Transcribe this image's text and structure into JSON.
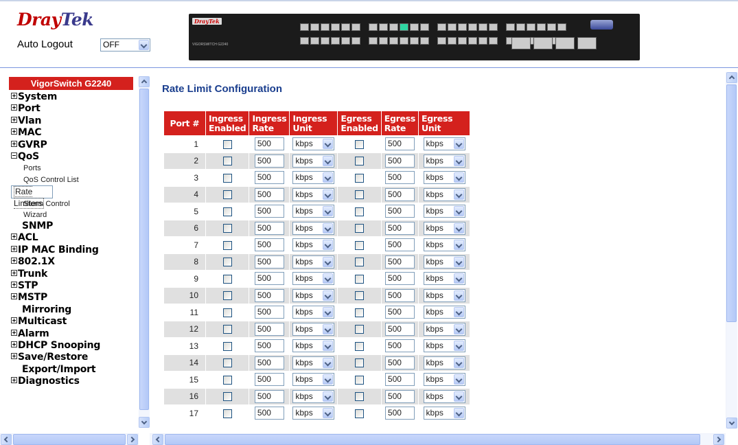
{
  "header": {
    "logo_primary": "Dray",
    "logo_secondary": "Tek",
    "auto_logout_label": "Auto Logout",
    "auto_logout_value": "OFF",
    "device_brand": "DrayTek",
    "device_model": "VIGORSWITCH G2240"
  },
  "sidebar": {
    "title": "VigorSwitch G2240",
    "items": [
      {
        "label": "System",
        "type": "plus"
      },
      {
        "label": "Port",
        "type": "plus"
      },
      {
        "label": "Vlan",
        "type": "plus"
      },
      {
        "label": "MAC",
        "type": "plus"
      },
      {
        "label": "GVRP",
        "type": "plus"
      },
      {
        "label": "QoS",
        "type": "minus"
      },
      {
        "label": "Ports",
        "type": "sub"
      },
      {
        "label": "QoS Control List",
        "type": "sub"
      },
      {
        "label": "Rate Limiters",
        "type": "sub-selected"
      },
      {
        "label": "Storm Control",
        "type": "sub"
      },
      {
        "label": "Wizard",
        "type": "sub"
      },
      {
        "label": "SNMP",
        "type": "none"
      },
      {
        "label": "ACL",
        "type": "plus"
      },
      {
        "label": "IP MAC Binding",
        "type": "plus"
      },
      {
        "label": "802.1X",
        "type": "plus"
      },
      {
        "label": "Trunk",
        "type": "plus"
      },
      {
        "label": "STP",
        "type": "plus"
      },
      {
        "label": "MSTP",
        "type": "plus"
      },
      {
        "label": "Mirroring",
        "type": "none"
      },
      {
        "label": "Multicast",
        "type": "plus"
      },
      {
        "label": "Alarm",
        "type": "plus"
      },
      {
        "label": "DHCP Snooping",
        "type": "plus"
      },
      {
        "label": "Save/Restore",
        "type": "plus"
      },
      {
        "label": "Export/Import",
        "type": "none"
      },
      {
        "label": "Diagnostics",
        "type": "plus"
      }
    ]
  },
  "main": {
    "title": "Rate Limit Configuration",
    "columns": [
      {
        "line1": "Port #",
        "line2": ""
      },
      {
        "line1": "Ingress",
        "line2": "Enabled"
      },
      {
        "line1": "Ingress",
        "line2": "Rate"
      },
      {
        "line1": "Ingress",
        "line2": "Unit"
      },
      {
        "line1": "Egress",
        "line2": "Enabled"
      },
      {
        "line1": "Egress",
        "line2": "Rate"
      },
      {
        "line1": "Egress",
        "line2": "Unit"
      }
    ],
    "rows": [
      {
        "port": "1",
        "ingress_enabled": false,
        "ingress_rate": "500",
        "ingress_unit": "kbps",
        "egress_enabled": false,
        "egress_rate": "500",
        "egress_unit": "kbps"
      },
      {
        "port": "2",
        "ingress_enabled": false,
        "ingress_rate": "500",
        "ingress_unit": "kbps",
        "egress_enabled": false,
        "egress_rate": "500",
        "egress_unit": "kbps"
      },
      {
        "port": "3",
        "ingress_enabled": false,
        "ingress_rate": "500",
        "ingress_unit": "kbps",
        "egress_enabled": false,
        "egress_rate": "500",
        "egress_unit": "kbps"
      },
      {
        "port": "4",
        "ingress_enabled": false,
        "ingress_rate": "500",
        "ingress_unit": "kbps",
        "egress_enabled": false,
        "egress_rate": "500",
        "egress_unit": "kbps"
      },
      {
        "port": "5",
        "ingress_enabled": false,
        "ingress_rate": "500",
        "ingress_unit": "kbps",
        "egress_enabled": false,
        "egress_rate": "500",
        "egress_unit": "kbps"
      },
      {
        "port": "6",
        "ingress_enabled": false,
        "ingress_rate": "500",
        "ingress_unit": "kbps",
        "egress_enabled": false,
        "egress_rate": "500",
        "egress_unit": "kbps"
      },
      {
        "port": "7",
        "ingress_enabled": false,
        "ingress_rate": "500",
        "ingress_unit": "kbps",
        "egress_enabled": false,
        "egress_rate": "500",
        "egress_unit": "kbps"
      },
      {
        "port": "8",
        "ingress_enabled": false,
        "ingress_rate": "500",
        "ingress_unit": "kbps",
        "egress_enabled": false,
        "egress_rate": "500",
        "egress_unit": "kbps"
      },
      {
        "port": "9",
        "ingress_enabled": false,
        "ingress_rate": "500",
        "ingress_unit": "kbps",
        "egress_enabled": false,
        "egress_rate": "500",
        "egress_unit": "kbps"
      },
      {
        "port": "10",
        "ingress_enabled": false,
        "ingress_rate": "500",
        "ingress_unit": "kbps",
        "egress_enabled": false,
        "egress_rate": "500",
        "egress_unit": "kbps"
      },
      {
        "port": "11",
        "ingress_enabled": false,
        "ingress_rate": "500",
        "ingress_unit": "kbps",
        "egress_enabled": false,
        "egress_rate": "500",
        "egress_unit": "kbps"
      },
      {
        "port": "12",
        "ingress_enabled": false,
        "ingress_rate": "500",
        "ingress_unit": "kbps",
        "egress_enabled": false,
        "egress_rate": "500",
        "egress_unit": "kbps"
      },
      {
        "port": "13",
        "ingress_enabled": false,
        "ingress_rate": "500",
        "ingress_unit": "kbps",
        "egress_enabled": false,
        "egress_rate": "500",
        "egress_unit": "kbps"
      },
      {
        "port": "14",
        "ingress_enabled": false,
        "ingress_rate": "500",
        "ingress_unit": "kbps",
        "egress_enabled": false,
        "egress_rate": "500",
        "egress_unit": "kbps"
      },
      {
        "port": "15",
        "ingress_enabled": false,
        "ingress_rate": "500",
        "ingress_unit": "kbps",
        "egress_enabled": false,
        "egress_rate": "500",
        "egress_unit": "kbps"
      },
      {
        "port": "16",
        "ingress_enabled": false,
        "ingress_rate": "500",
        "ingress_unit": "kbps",
        "egress_enabled": false,
        "egress_rate": "500",
        "egress_unit": "kbps"
      },
      {
        "port": "17",
        "ingress_enabled": false,
        "ingress_rate": "500",
        "ingress_unit": "kbps",
        "egress_enabled": false,
        "egress_rate": "500",
        "egress_unit": "kbps"
      }
    ]
  },
  "colors": {
    "accent_red": "#d4211d",
    "title_blue": "#1a3e8e",
    "row_alt": "#e0e0e0"
  },
  "icons": {
    "expand": "plus-box-icon",
    "collapse": "minus-box-icon",
    "dropdown": "chevron-down-icon",
    "scroll_up": "arrow-up-icon",
    "scroll_down": "arrow-down-icon",
    "scroll_left": "arrow-left-icon",
    "scroll_right": "arrow-right-icon"
  }
}
